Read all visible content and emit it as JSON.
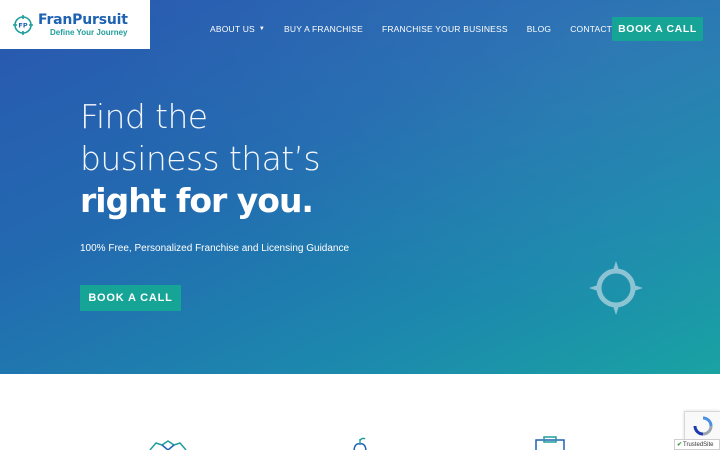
{
  "brand": {
    "name": "FranPursuit",
    "tagline": "Define Your Journey",
    "logo_mark_text": "FP",
    "primary_color": "#1e62b2",
    "accent_color": "#1f9e9c"
  },
  "nav": {
    "items": [
      {
        "label": "ABOUT US",
        "has_dropdown": true
      },
      {
        "label": "BUY A FRANCHISE",
        "has_dropdown": false
      },
      {
        "label": "FRANCHISE YOUR BUSINESS",
        "has_dropdown": false
      },
      {
        "label": "BLOG",
        "has_dropdown": false
      },
      {
        "label": "CONTACT US",
        "has_dropdown": false
      }
    ],
    "cta_label": "BOOK A CALL",
    "cta_color": "#16a497",
    "dropdown_icon": "chevron-down-icon"
  },
  "hero": {
    "headline_line1": "Find the",
    "headline_line2": "business that’s",
    "headline_line3": "right for you.",
    "subheadline": "100% Free, Personalized Franchise and Licensing Guidance",
    "cta_label": "BOOK A CALL",
    "decorative_icon": "compass-icon",
    "gradient_colors": [
      "#2a57b0",
      "#1aa3a3"
    ]
  },
  "features": {
    "icons": [
      "handshake-icon",
      "apple-icon",
      "clipboard-icon"
    ]
  },
  "widgets": {
    "recaptcha_icon": "recaptcha-icon",
    "trusted_badge": "TrustedSite"
  }
}
